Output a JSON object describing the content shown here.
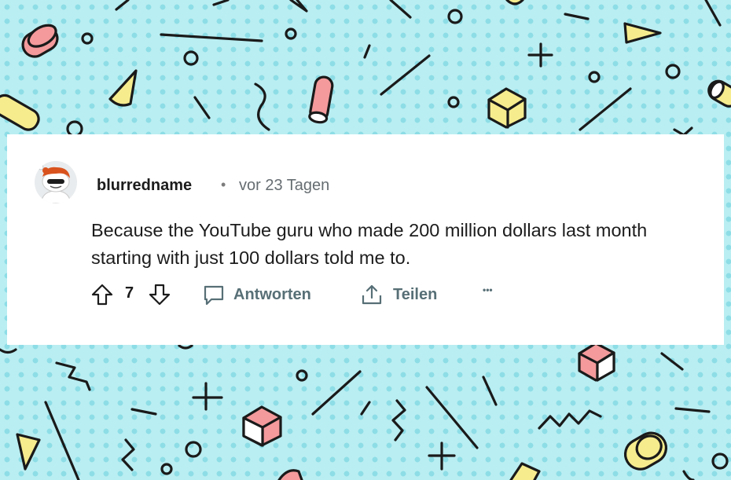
{
  "background": {
    "base_color": "#b9eef2",
    "dot_color": "#8ddde6",
    "pattern": "memphis-confetti"
  },
  "comment": {
    "username": "blurredname",
    "separator": "•",
    "timestamp": "vor 23 Tagen",
    "avatar_icon": "reddit-snoo-avatar-icon",
    "body": "Because the YouTube guru who made 200 million dollars last month starting with just 100 dollars told me to."
  },
  "actions": {
    "upvote_icon": "arrow-up-outline-icon",
    "vote_count": "7",
    "downvote_icon": "arrow-down-outline-icon",
    "reply_icon": "speech-bubble-icon",
    "reply_label": "Antworten",
    "share_icon": "share-upload-icon",
    "share_label": "Teilen",
    "more_icon": "ellipsis-icon",
    "more_label": "•••"
  },
  "colors": {
    "card_bg": "#ffffff",
    "text_primary": "#1c1c1c",
    "text_secondary": "#576f76",
    "pink": "#f49a9c",
    "yellow": "#f6ec8e"
  }
}
